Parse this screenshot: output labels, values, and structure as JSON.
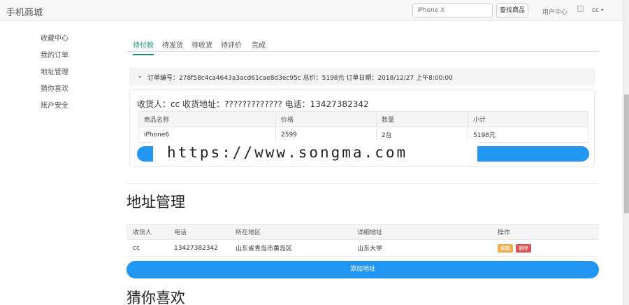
{
  "nav": {
    "brand": "手机商城",
    "search_placeholder": "iPhone X",
    "search_button": "查找商品",
    "user_center": "用户中心",
    "username": "cc",
    "caret": "▾"
  },
  "sidebar": {
    "items": [
      {
        "label": "收藏中心"
      },
      {
        "label": "我的订单"
      },
      {
        "label": "地址管理"
      },
      {
        "label": "猜你喜欢"
      },
      {
        "label": "账户安全"
      }
    ]
  },
  "tabs": [
    {
      "label": "待付款"
    },
    {
      "label": "待发货"
    },
    {
      "label": "待收货"
    },
    {
      "label": "待评价"
    },
    {
      "label": "完成"
    }
  ],
  "order": {
    "chevron": "⌄",
    "summary": "订单编号：278f58c4ca4643a3acd61cae8d3ec95c 总价：5198元 订单日期：2018/12/27 上午8:00:00",
    "receiver_line": "收货人：cc 收货地址：????????????? 电话：13427382342",
    "columns": [
      "商品名称",
      "价格",
      "数量",
      "小计"
    ],
    "rows": [
      [
        "iPhone6",
        "2599",
        "2台",
        "5198元"
      ]
    ]
  },
  "watermark": "https://www.songma.com",
  "address": {
    "title": "地址管理",
    "columns": [
      "收货人",
      "电话",
      "所在地区",
      "详细地址",
      "操作"
    ],
    "rows": [
      {
        "name": "cc",
        "phone": "13427382342",
        "region": "山东省青岛市黄岛区",
        "detail": "山东大学",
        "edit": "编辑",
        "delete": "删除"
      }
    ],
    "add_button": "添加地址"
  },
  "guess": {
    "title": "猜你喜欢"
  },
  "colors": {
    "accent": "#1a8f6a",
    "primary": "#2196f3",
    "edit": "#f0ad4e",
    "delete": "#d9534f"
  }
}
